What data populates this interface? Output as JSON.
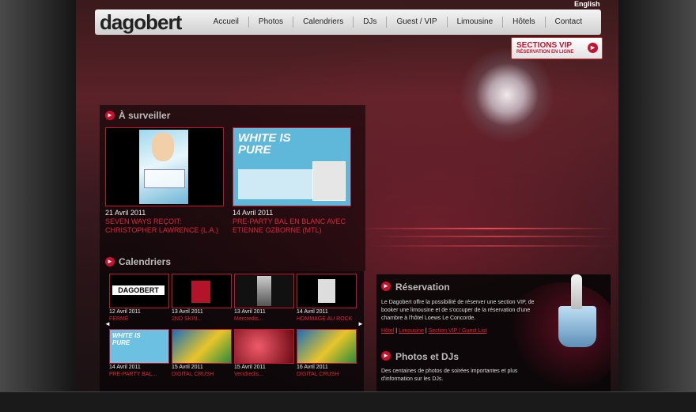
{
  "header": {
    "logo": "dagobert",
    "lang": "English",
    "nav": [
      "Accueil",
      "Photos",
      "Calendriers",
      "DJs",
      "Guest / VIP",
      "Limousine",
      "Hôtels",
      "Contact"
    ]
  },
  "vip": {
    "title": "SECTIONS VIP",
    "subtitle": "RÉSERVATION EN LIGNE"
  },
  "watch": {
    "title": "À surveiller",
    "items": [
      {
        "date": "21 Avril 2011",
        "title": "Seven Ways reçoit: CHRISTOPHER LAWRENCE (L.A.)"
      },
      {
        "date": "14 Avril 2011",
        "title": "PRE-PARTY BAL EN BLANC AVEC ETIENNE OZBORNE (MTL)"
      }
    ]
  },
  "calendars": {
    "title": "Calendriers",
    "items": [
      {
        "date": "12 Avril 2011",
        "label": "FERMÉ"
      },
      {
        "date": "13 Avril 2011",
        "label": "2ND SKIN..."
      },
      {
        "date": "13 Avril 2011",
        "label": "Mercredis..."
      },
      {
        "date": "14 Avril 2011",
        "label": "HOMMAGE AU ROCK"
      },
      {
        "date": "14 Avril 2011",
        "label": "PRE-PARTY BAL..."
      },
      {
        "date": "15 Avril 2011",
        "label": "DIGITAL CRUSH"
      },
      {
        "date": "15 Avril 2011",
        "label": "Vendredis..."
      },
      {
        "date": "16 Avril 2011",
        "label": "DIGITAL CRUSH"
      }
    ]
  },
  "reservation": {
    "title": "Réservation",
    "body": "Le Dagobert offre la possibilité de réserver une section VIP, de booker une limousine et de s'occuper de la réservation d'une chambre à l'hôtel Loews Le Concorde.",
    "links": [
      "Hôtel",
      "Limousine",
      "Section VIP / Guest List"
    ]
  },
  "photos": {
    "title": "Photos et DJs",
    "body": "Des centaines de photos de soirées importantes et plus d'information sur les DJs."
  },
  "thumbs": {
    "dagobert": "DAGOBERT",
    "white": "WHITE IS PURE"
  },
  "colors": {
    "accent": "#c8102e"
  }
}
